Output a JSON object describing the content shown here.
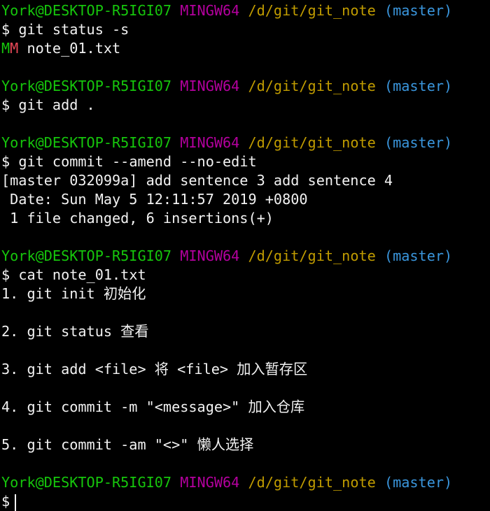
{
  "colors": {
    "background": "#000000",
    "text": "#f2f2f2",
    "user_host": "#16c60c",
    "msystem": "#b4009e",
    "path": "#c19c00",
    "branch": "#3a96dd",
    "modified": "#e74856"
  },
  "prompt": {
    "user_host": "York@DESKTOP-R5IGI07",
    "msystem": "MINGW64",
    "path": "/d/git/git_note",
    "branch": "(master)",
    "symbol": "$"
  },
  "session": {
    "cmd1": "git status -s",
    "status_flag_1": "M",
    "status_flag_2": "M",
    "status_file": "note_01.txt",
    "cmd2": "git add .",
    "cmd3": "git commit --amend --no-edit",
    "commit_line": "[master 032099a] add sentence 3 add sentence 4",
    "date_line": " Date: Sun May 5 12:11:57 2019 +0800",
    "summary_line": " 1 file changed, 6 insertions(+)",
    "cmd4": "cat note_01.txt",
    "file_lines": [
      "1. git init 初始化",
      "2. git status 查看",
      "3. git add <file> 将 <file> 加入暂存区",
      "4. git commit -m \"<message>\" 加入仓库",
      "5. git commit -am \"<>\" 懒人选择"
    ]
  }
}
